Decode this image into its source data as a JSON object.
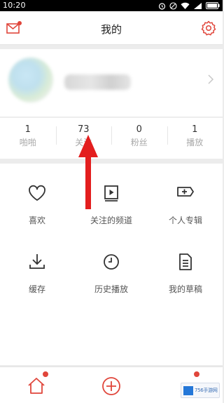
{
  "status_bar": {
    "time": "10:20"
  },
  "header": {
    "title": "我的",
    "left_icon": "mail-icon",
    "right_icon": "gear-icon"
  },
  "profile": {
    "has_avatar": true,
    "username_blurred": true
  },
  "stats": [
    {
      "value": "1",
      "label": "啪啪"
    },
    {
      "value": "73",
      "label": "关注"
    },
    {
      "value": "0",
      "label": "粉丝"
    },
    {
      "value": "1",
      "label": "播放"
    }
  ],
  "menu": [
    {
      "label": "喜欢",
      "icon": "heart-icon"
    },
    {
      "label": "关注的频道",
      "icon": "channel-icon"
    },
    {
      "label": "个人专辑",
      "icon": "album-icon"
    },
    {
      "label": "缓存",
      "icon": "download-icon"
    },
    {
      "label": "历史播放",
      "icon": "history-icon"
    },
    {
      "label": "我的草稿",
      "icon": "draft-icon"
    }
  ],
  "tabbar": [
    {
      "icon": "home-icon",
      "has_badge": true
    },
    {
      "icon": "add-icon",
      "has_badge": false
    },
    {
      "icon": "profile-icon",
      "has_badge": true
    }
  ],
  "watermark": {
    "text": "756手游网"
  },
  "colors": {
    "accent": "#e0463b",
    "annotation_arrow": "#e31e1e",
    "icon": "#333333"
  }
}
